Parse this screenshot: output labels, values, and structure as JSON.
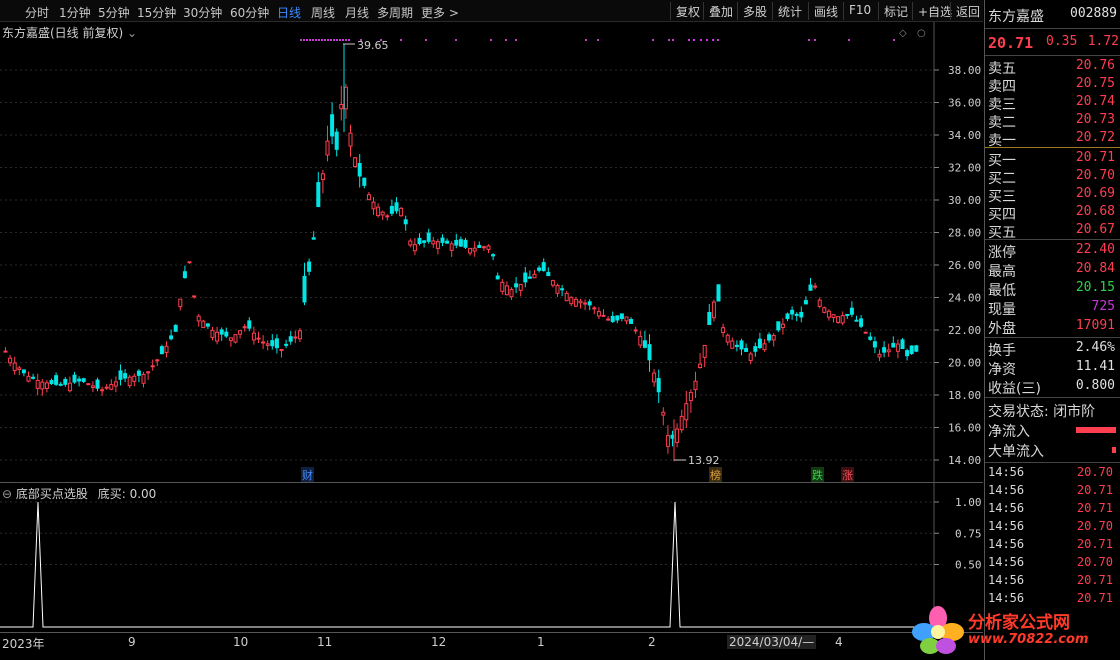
{
  "toolbar": {
    "periods": [
      "分时",
      "1分钟",
      "5分钟",
      "15分钟",
      "30分钟",
      "60分钟",
      "日线",
      "周线",
      "月线",
      "多周期",
      "更多"
    ],
    "active_period": "日线",
    "more_arrow": ">",
    "right_buttons": [
      "复权",
      "叠加",
      "多股",
      "统计",
      "画线",
      "F10",
      "标记",
      "+自选",
      "返回"
    ]
  },
  "chart": {
    "title": "东方嘉盛(日线 前复权)",
    "high_label": "39.65",
    "low_label": "13.92",
    "price_ticks": [
      "38.00",
      "36.00",
      "34.00",
      "32.00",
      "30.00",
      "28.00",
      "26.00",
      "24.00",
      "22.00",
      "20.00",
      "18.00",
      "16.00",
      "14.00"
    ],
    "markers": [
      {
        "text": "财",
        "color": "#2f6dd8"
      },
      {
        "text": "榜",
        "color": "#c88a2a"
      },
      {
        "text": "跌",
        "color": "#2faa3a"
      },
      {
        "text": "涨",
        "color": "#c8303a"
      }
    ],
    "colors": {
      "up": "#ff3f4f",
      "down": "#00e5e5",
      "dots": "#c83ad8"
    }
  },
  "indicator": {
    "title": "底部买点选股",
    "value_label": "底买: 0.00",
    "ticks": [
      "1.00",
      "0.75",
      "0.50"
    ]
  },
  "xaxis": {
    "labels": [
      "2023年",
      "9",
      "10",
      "11",
      "12",
      "1",
      "2",
      "2024/03/04/—",
      "4"
    ]
  },
  "quote": {
    "name": "东方嘉盛",
    "code": "002889",
    "price": "20.71",
    "change": "0.35",
    "change_pct": "1.72",
    "asks": [
      {
        "label": "卖五",
        "price": "20.76"
      },
      {
        "label": "卖四",
        "price": "20.75"
      },
      {
        "label": "卖三",
        "price": "20.74"
      },
      {
        "label": "卖二",
        "price": "20.73"
      },
      {
        "label": "卖一",
        "price": "20.72"
      }
    ],
    "bids": [
      {
        "label": "买一",
        "price": "20.71"
      },
      {
        "label": "买二",
        "price": "20.70"
      },
      {
        "label": "买三",
        "price": "20.69"
      },
      {
        "label": "买四",
        "price": "20.68"
      },
      {
        "label": "买五",
        "price": "20.67"
      }
    ],
    "stats": [
      {
        "label": "涨停",
        "value": "22.40",
        "color": "red"
      },
      {
        "label": "最高",
        "value": "20.84",
        "color": "red"
      },
      {
        "label": "最低",
        "value": "20.15",
        "color": "green"
      },
      {
        "label": "现量",
        "value": "725",
        "color": "purple"
      },
      {
        "label": "外盘",
        "value": "17091",
        "color": "red"
      }
    ],
    "stats2": [
      {
        "label": "换手",
        "value": "2.46%"
      },
      {
        "label": "净资",
        "value": "11.41"
      },
      {
        "label": "收益(三)",
        "value": "0.800"
      }
    ],
    "trade_status": "交易状态: 闭市阶",
    "flows": [
      {
        "label": "净流入",
        "value": 0.9
      },
      {
        "label": "大单流入",
        "value": 0.1
      }
    ],
    "ticks": [
      {
        "time": "14:56",
        "price": "20.70"
      },
      {
        "time": "14:56",
        "price": "20.71"
      },
      {
        "time": "14:56",
        "price": "20.71"
      },
      {
        "time": "14:56",
        "price": "20.70"
      },
      {
        "time": "14:56",
        "price": "20.71"
      },
      {
        "time": "14:56",
        "price": "20.70"
      },
      {
        "time": "14:56",
        "price": "20.71"
      },
      {
        "time": "14:56",
        "price": "20.71"
      }
    ]
  },
  "watermark": {
    "text": "分析家公式网",
    "url": "www.70822.com"
  }
}
